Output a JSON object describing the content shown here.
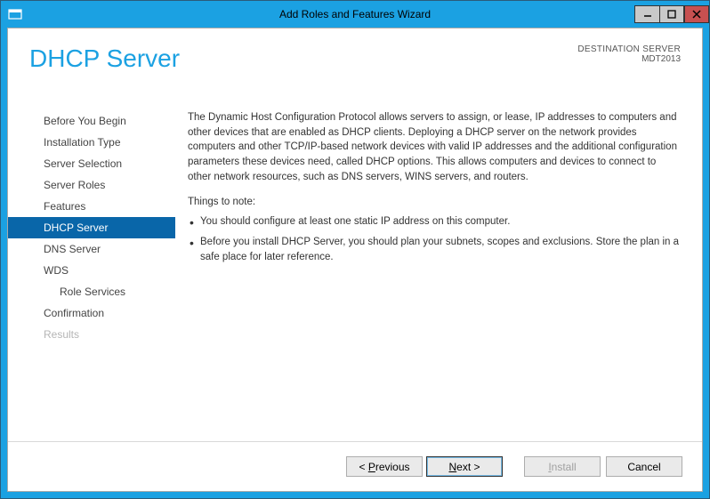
{
  "window": {
    "title": "Add Roles and Features Wizard"
  },
  "header": {
    "page_title": "DHCP Server",
    "destination_label": "DESTINATION SERVER",
    "destination_value": "MDT2013"
  },
  "sidebar": {
    "items": [
      {
        "label": "Before You Begin",
        "selected": false,
        "disabled": false,
        "indent": false
      },
      {
        "label": "Installation Type",
        "selected": false,
        "disabled": false,
        "indent": false
      },
      {
        "label": "Server Selection",
        "selected": false,
        "disabled": false,
        "indent": false
      },
      {
        "label": "Server Roles",
        "selected": false,
        "disabled": false,
        "indent": false
      },
      {
        "label": "Features",
        "selected": false,
        "disabled": false,
        "indent": false
      },
      {
        "label": "DHCP Server",
        "selected": true,
        "disabled": false,
        "indent": false
      },
      {
        "label": "DNS Server",
        "selected": false,
        "disabled": false,
        "indent": false
      },
      {
        "label": "WDS",
        "selected": false,
        "disabled": false,
        "indent": false
      },
      {
        "label": "Role Services",
        "selected": false,
        "disabled": false,
        "indent": true
      },
      {
        "label": "Confirmation",
        "selected": false,
        "disabled": false,
        "indent": false
      },
      {
        "label": "Results",
        "selected": false,
        "disabled": true,
        "indent": false
      }
    ]
  },
  "content": {
    "paragraph": "The Dynamic Host Configuration Protocol allows servers to assign, or lease, IP addresses to computers and other devices that are enabled as DHCP clients. Deploying a DHCP server on the network provides computers and other TCP/IP-based network devices with valid IP addresses and the additional configuration parameters these devices need, called DHCP options. This allows computers and devices to connect to other network resources, such as DNS servers, WINS servers, and routers.",
    "notes_heading": "Things to note:",
    "bullets": [
      "You should configure at least one static IP address on this computer.",
      "Before you install DHCP Server, you should plan your subnets, scopes and exclusions. Store the plan in a safe place for later reference."
    ]
  },
  "footer": {
    "previous": "Previous",
    "next": "Next",
    "install": "Install",
    "cancel": "Cancel"
  }
}
